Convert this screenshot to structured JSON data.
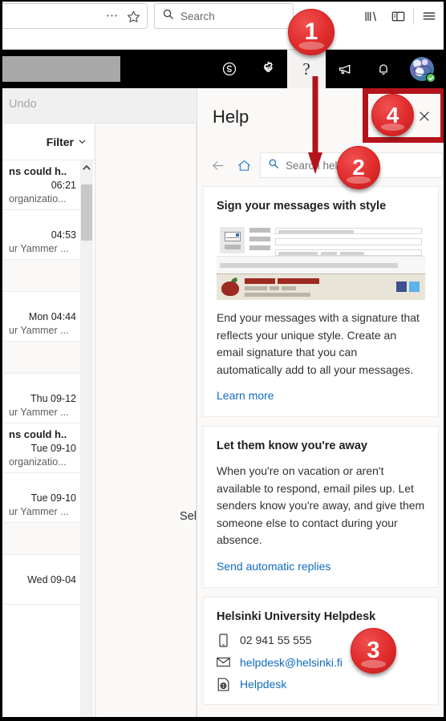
{
  "browser": {
    "urlbar": {
      "more_icon": "ellipsis-icon",
      "bookmark_icon": "star-icon",
      "value": ""
    },
    "search": {
      "placeholder": "Search",
      "icon": "search-icon"
    },
    "toolbar_icons": [
      "library-icon",
      "sidebar-toggle-icon",
      "hamburger-menu-icon"
    ]
  },
  "suitebar": {
    "redacted_label": "",
    "icons": [
      "skype-icon",
      "settings-gear-icon",
      "help-question-icon",
      "megaphone-icon",
      "bell-icon",
      "avatar"
    ],
    "help_glyph": "?",
    "presence": "available"
  },
  "commandbar": {
    "undo_label": "Undo"
  },
  "maillist": {
    "filter_label": "Filter",
    "rows": [
      {
        "subject": "ns could h..",
        "time": "06:21",
        "preview": "organizatio..."
      },
      {
        "subject": "",
        "time": "04:53",
        "preview": "ur Yammer ..."
      },
      {
        "subject": "",
        "time": "",
        "preview": ""
      },
      {
        "subject": "",
        "time": "Mon 04:44",
        "preview": "ur Yammer ..."
      },
      {
        "subject": "",
        "time": "",
        "preview": ""
      },
      {
        "subject": "",
        "time": "Thu 09-12",
        "preview": "ur Yammer ..."
      },
      {
        "subject": "ns could h..",
        "time": "Tue 09-10",
        "preview": "organizatio..."
      },
      {
        "subject": "",
        "time": "Tue 09-10",
        "preview": "ur Yammer ..."
      },
      {
        "subject": "",
        "time": "",
        "preview": ""
      },
      {
        "subject": "",
        "time": "Wed 09-04",
        "preview": ""
      }
    ]
  },
  "readingpane": {
    "empty_text": "Sel"
  },
  "help": {
    "title": "Help",
    "close_label": "✕",
    "back_icon": "back-arrow-icon",
    "home_icon": "home-icon",
    "search": {
      "placeholder": "Search help",
      "value": "",
      "icon": "search-icon"
    },
    "cards": [
      {
        "heading": "Sign your messages with style",
        "body": "End your messages with a signature that reflects your unique style. Create an email signature that you can automatically add to all your messages.",
        "link": "Learn more",
        "has_image": true
      },
      {
        "heading": "Let them know you're away",
        "body": "When you're on vacation or aren't available to respond, email piles up. Let senders know you're away, and give them someone else to contact during your absence.",
        "link": "Send automatic replies",
        "has_image": false
      }
    ],
    "contact": {
      "heading": "Helsinki University Helpdesk",
      "phone": "02 941 55 555",
      "email": "helpdesk@helsinki.fi",
      "website": "Helpdesk"
    }
  },
  "annotations": {
    "color": "#e02b2b",
    "arrow_color": "#b3141c",
    "markers": [
      {
        "id": 1,
        "label": "1"
      },
      {
        "id": 2,
        "label": "2"
      },
      {
        "id": 3,
        "label": "3"
      },
      {
        "id": 4,
        "label": "4"
      }
    ]
  }
}
